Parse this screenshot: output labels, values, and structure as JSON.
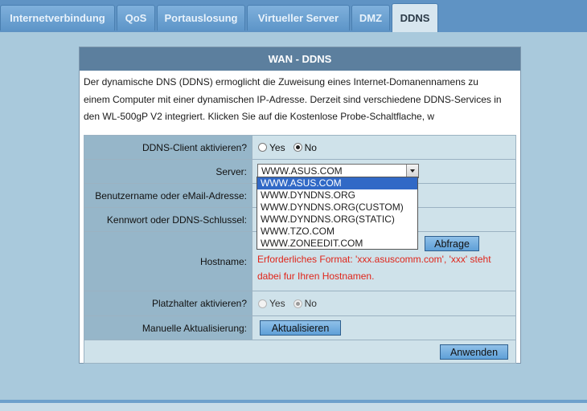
{
  "tabs": [
    {
      "label": "Internetverbindung",
      "active": false
    },
    {
      "label": "QoS",
      "active": false
    },
    {
      "label": "Portauslosung",
      "active": false
    },
    {
      "label": "Virtueller Server",
      "active": false
    },
    {
      "label": "DMZ",
      "active": false
    },
    {
      "label": "DDNS",
      "active": true
    }
  ],
  "panel": {
    "title": "WAN - DDNS",
    "description_lines": [
      "Der dynamische DNS (DDNS) ermoglicht die Zuweisung eines Internet-Domanennamens zu",
      "einem Computer mit einer dynamischen IP-Adresse. Derzeit sind verschiedene DDNS-Services in",
      "den WL-500gP V2 integriert. Klicken Sie auf die Kostenlose Probe-Schaltflache, w"
    ]
  },
  "form": {
    "client_enable": {
      "label": "DDNS-Client aktivieren?",
      "yes": "Yes",
      "no": "No",
      "selected": "No"
    },
    "server": {
      "label": "Server:",
      "selected": "WWW.ASUS.COM",
      "options": [
        "WWW.ASUS.COM",
        "WWW.DYNDNS.ORG",
        "WWW.DYNDNS.ORG(CUSTOM)",
        "WWW.DYNDNS.ORG(STATIC)",
        "WWW.TZO.COM",
        "WWW.ZONEEDIT.COM"
      ]
    },
    "username": {
      "label": "Benutzername oder eMail-Adresse:"
    },
    "password": {
      "label": "Kennwort oder DDNS-Schlussel:"
    },
    "hostname": {
      "label": "Hostname:",
      "query_button": "Abfrage",
      "hint_line1": "Erforderliches Format: 'xxx.asuscomm.com', 'xxx' steht",
      "hint_line2": "dabei fur Ihren Hostnamen."
    },
    "wildcard": {
      "label": "Platzhalter aktivieren?",
      "yes": "Yes",
      "no": "No",
      "selected": "No"
    },
    "manual_update": {
      "label": "Manuelle Aktualisierung:",
      "button": "Aktualisieren"
    },
    "apply_button": "Anwenden"
  },
  "colors": {
    "tab_bar": "#5f93c4",
    "panel_header": "#5c7f9e",
    "label_cell": "#96b6c9",
    "value_cell": "#cfe2ea",
    "hint_text": "#e0251a",
    "dropdown_highlight": "#3169c6"
  },
  "icons": {
    "select_arrow": "chevron-down-icon"
  }
}
